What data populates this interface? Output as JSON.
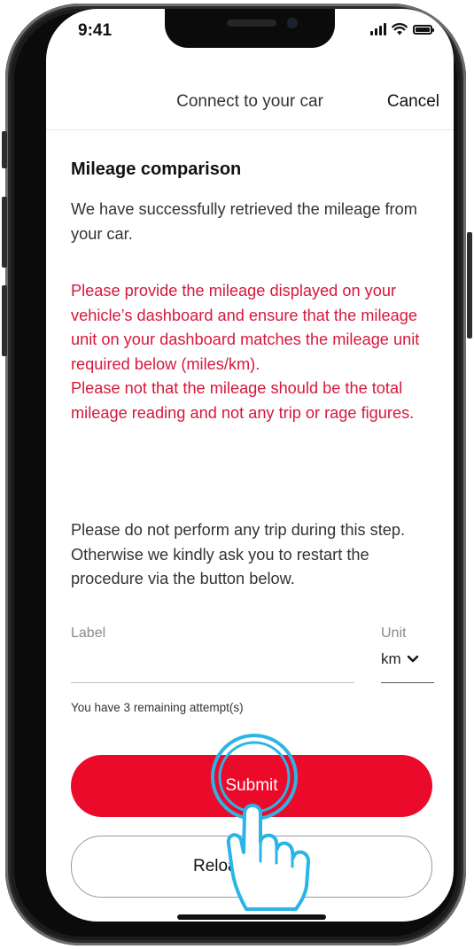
{
  "status_bar": {
    "time": "9:41"
  },
  "header": {
    "title": "Connect to your car",
    "cancel_label": "Cancel"
  },
  "section_title": "Mileage comparison",
  "intro_text": "We have successfully retrieved the mileage from your car.",
  "warning_text_1": "Please provide the mileage displayed on your vehicle’s dashboard and ensure that the mileage unit on your dashboard matches the mileage unit required below (miles/km).",
  "warning_text_2": "Please not that the mileage should be the total mileage reading and not any trip or rage figures.",
  "note_text": "Please do not perform any trip during this step. Otherwise we kindly ask you to restart the procedure via the button below.",
  "form": {
    "mileage_label": "Label",
    "unit_label": "Unit",
    "unit_value": "km",
    "attempts_text": "You have 3 remaining attempt(s)"
  },
  "buttons": {
    "submit_label": "Submit",
    "reload_label": "Reload mileage"
  },
  "colors": {
    "accent": "#ec0a2a",
    "warning": "#d6183b",
    "tap_highlight": "#2bb4e6"
  },
  "icons": [
    "signal-icon",
    "wifi-icon",
    "battery-icon",
    "chevron-down-icon",
    "tap-hand-icon"
  ]
}
